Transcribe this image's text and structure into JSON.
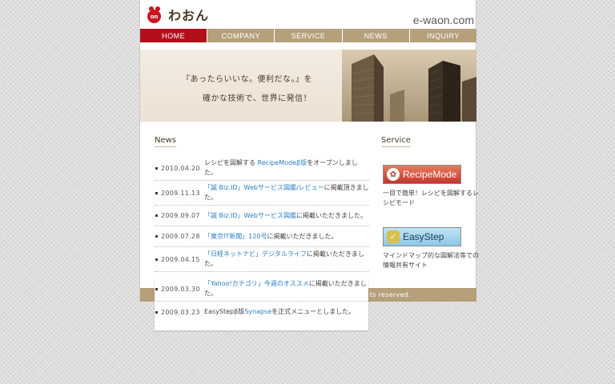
{
  "header": {
    "logo_mark": "on",
    "logo_text": "わおん",
    "domain": "e-waon.com"
  },
  "nav": [
    {
      "label": "HOME",
      "active": true
    },
    {
      "label": "COMPANY"
    },
    {
      "label": "SERVICE"
    },
    {
      "label": "NEWS"
    },
    {
      "label": "INQUIRY"
    }
  ],
  "hero": {
    "line1": "『あったらいいな。便利だな。』を",
    "line2": "確かな技術で、世界に発信！"
  },
  "news": {
    "title": "News",
    "items": [
      {
        "date": "2010.04.20",
        "pre": "レシピを図解する ",
        "link": "RecipeModeβ版",
        "post": "をオープンしました。"
      },
      {
        "date": "2009.11.13",
        "pre": "",
        "link": "「誠 Biz.ID」Webサービス図鑑/レビュー",
        "post": "に掲載頂きました。"
      },
      {
        "date": "2009.09.07",
        "pre": "",
        "link": "「誠 Biz.ID」Webサービス図鑑",
        "post": "に掲載いただきました。"
      },
      {
        "date": "2009.07.28",
        "pre": "",
        "link": "「東京IT新聞」120号",
        "post": "に掲載いただきました。"
      },
      {
        "date": "2009.04.15",
        "pre": "",
        "link": "「日経ネットナビ」デジタルライフ",
        "post": "に掲載いただきました。"
      },
      {
        "date": "2009.03.30",
        "pre": "",
        "link": "「Yahoo!カテゴリ」今週のオススメ",
        "post": "に掲載いただきました。"
      },
      {
        "date": "2009.03.23",
        "pre": "EasyStepβ版",
        "link": "Synapse",
        "post": "を正式メニューとしました。"
      }
    ]
  },
  "service": {
    "title": "Service",
    "recipe": {
      "label": "RecipeMode",
      "desc": "一目で簡単！レシピを図解するレシピモード"
    },
    "easy": {
      "label": "EasyStep",
      "desc": "マインドマップ的な図解法等での情報共有サイト"
    }
  },
  "footer": {
    "text": "ts reserved."
  },
  "colors": {
    "accent_red": "#b1101b",
    "nav_tan": "#b5a07a",
    "link_blue": "#2a7fc4"
  }
}
